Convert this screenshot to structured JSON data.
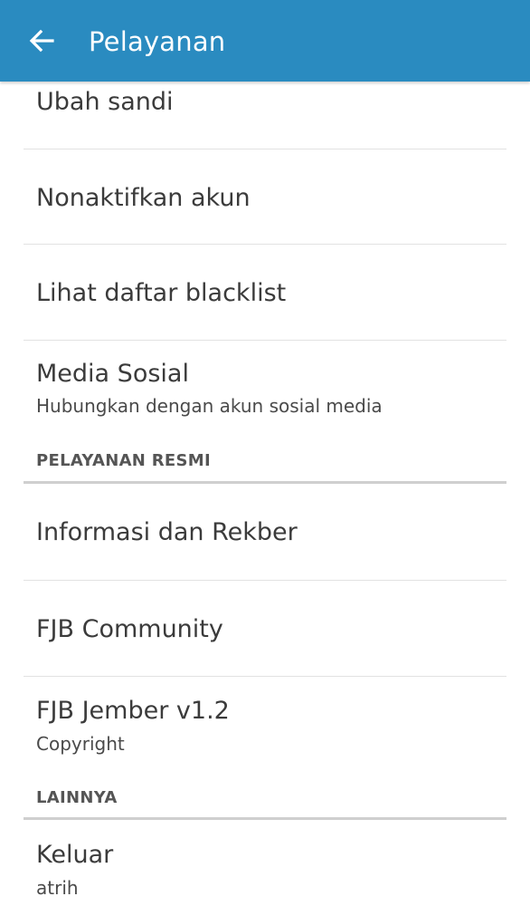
{
  "header": {
    "title": "Pelayanan",
    "back_icon": "arrow-left-icon",
    "background_color": "#2a8bc0"
  },
  "items_top": [
    {
      "title": "Ubah sandi"
    },
    {
      "title": "Nonaktifkan akun"
    },
    {
      "title": "Lihat daftar blacklist"
    },
    {
      "title": "Media Sosial",
      "subtitle": "Hubungkan dengan akun sosial media"
    }
  ],
  "section_official": {
    "header": "PELAYANAN RESMI",
    "items": [
      {
        "title": "Informasi dan Rekber"
      },
      {
        "title": "FJB Community"
      },
      {
        "title": "FJB Jember v1.2",
        "subtitle": "Copyright"
      }
    ]
  },
  "section_other": {
    "header": "LAINNYA",
    "items": [
      {
        "title": "Keluar",
        "subtitle": "atrih"
      }
    ]
  }
}
